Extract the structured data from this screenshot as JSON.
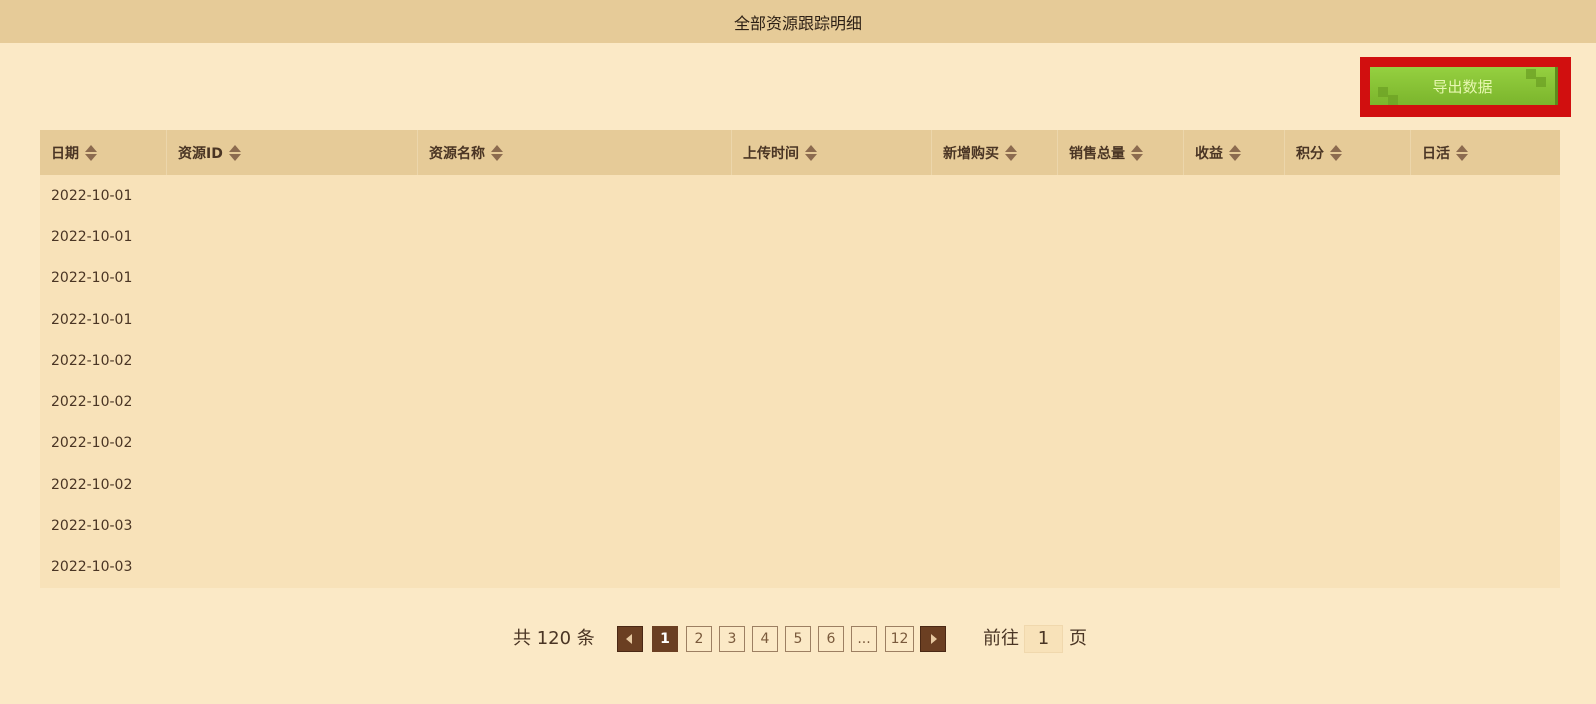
{
  "header": {
    "title": "全部资源跟踪明细"
  },
  "toolbar": {
    "export_label": "导出数据"
  },
  "table": {
    "columns": [
      {
        "key": "date",
        "label": "日期"
      },
      {
        "key": "resource_id",
        "label": "资源ID"
      },
      {
        "key": "resource_name",
        "label": "资源名称"
      },
      {
        "key": "upload_time",
        "label": "上传时间"
      },
      {
        "key": "new_purchase",
        "label": "新增购买"
      },
      {
        "key": "total_sales",
        "label": "销售总量"
      },
      {
        "key": "revenue",
        "label": "收益"
      },
      {
        "key": "points",
        "label": "积分"
      },
      {
        "key": "dau",
        "label": "日活"
      }
    ],
    "rows": [
      {
        "date": "2022-10-01"
      },
      {
        "date": "2022-10-01"
      },
      {
        "date": "2022-10-01"
      },
      {
        "date": "2022-10-01"
      },
      {
        "date": "2022-10-02"
      },
      {
        "date": "2022-10-02"
      },
      {
        "date": "2022-10-02"
      },
      {
        "date": "2022-10-02"
      },
      {
        "date": "2022-10-03"
      },
      {
        "date": "2022-10-03"
      }
    ]
  },
  "pagination": {
    "total_text": "共 120 条",
    "pages": [
      "1",
      "2",
      "3",
      "4",
      "5",
      "6",
      "...",
      "12"
    ],
    "current": "1",
    "prev_icon": "chevron-left-icon",
    "next_icon": "chevron-right-icon",
    "goto_prefix": "前往",
    "goto_value": "1",
    "goto_suffix": "页"
  }
}
